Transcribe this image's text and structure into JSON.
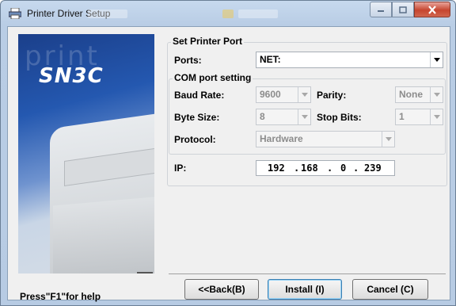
{
  "window": {
    "title": "Printer Driver Setup",
    "brand_logo": "SN3C",
    "banner_watermark": "print"
  },
  "title_buttons": {
    "minimize_icon": "minimize-icon",
    "maximize_icon": "maximize-icon",
    "close_icon": "close-icon"
  },
  "printer_port": {
    "group_label": "Set Printer Port",
    "ports_label": "Ports:",
    "ports_value": "NET:"
  },
  "com": {
    "group_label": "COM port setting",
    "baud_rate_label": "Baud Rate:",
    "baud_rate_value": "9600",
    "parity_label": "Parity:",
    "parity_value": "None",
    "byte_size_label": "Byte Size:",
    "byte_size_value": "8",
    "stop_bits_label": "Stop Bits:",
    "stop_bits_value": "1",
    "protocol_label": "Protocol:",
    "protocol_value": "Hardware"
  },
  "ip": {
    "label": "IP:",
    "octets": [
      "192",
      "168",
      "0",
      "239"
    ],
    "separator": "."
  },
  "footer": {
    "help_text": "Press\"F1\"for help",
    "back_label": "<<Back(B)",
    "install_label": "Install (I)",
    "cancel_label": "Cancel (C)"
  },
  "colors": {
    "close_button": "#c6452f",
    "banner_blue": "#2458b0",
    "title_bar": "#b9cde5"
  }
}
